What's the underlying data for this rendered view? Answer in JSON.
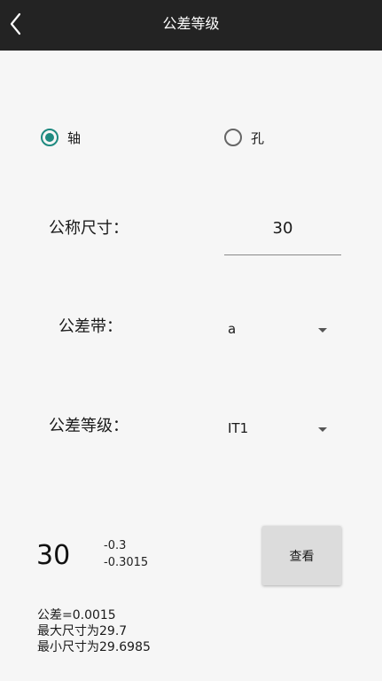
{
  "app_bar": {
    "title": "公差等级",
    "back_icon": "chevron-left-icon",
    "background": "#232323"
  },
  "part_type": {
    "options": [
      {
        "label": "轴",
        "checked": true
      },
      {
        "label": "孔",
        "checked": false
      }
    ],
    "accent": "#1f8a80"
  },
  "nominal_size": {
    "label": "公称尺寸：",
    "value": "30"
  },
  "tolerance_zone": {
    "label": "公差带：",
    "selected": "a"
  },
  "tolerance_grade": {
    "label": "公差等级：",
    "selected": "IT1"
  },
  "result": {
    "size": "30",
    "upper_deviation": "-0.3",
    "lower_deviation": "-0.3015",
    "view_button": "查看",
    "lines": [
      "公差=0.0015",
      "最大尺寸为29.7",
      "最小尺寸为29.6985"
    ]
  }
}
